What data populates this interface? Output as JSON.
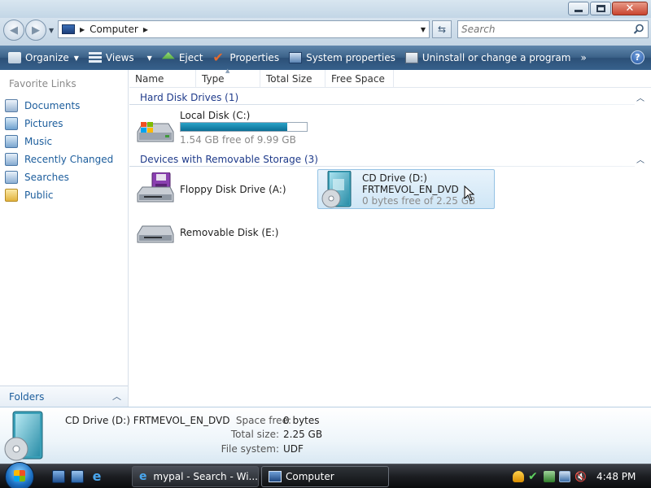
{
  "address": {
    "location": "Computer",
    "search_placeholder": "Search"
  },
  "toolbar": {
    "organize": "Organize",
    "views": "Views",
    "eject": "Eject",
    "properties": "Properties",
    "system_properties": "System properties",
    "uninstall": "Uninstall or change a program",
    "more": "»",
    "help": "?"
  },
  "nav": {
    "favorites_title": "Favorite Links",
    "items": [
      {
        "label": "Documents"
      },
      {
        "label": "Pictures"
      },
      {
        "label": "Music"
      },
      {
        "label": "Recently Changed"
      },
      {
        "label": "Searches"
      },
      {
        "label": "Public"
      }
    ],
    "folders_label": "Folders"
  },
  "columns": {
    "name": "Name",
    "type": "Type",
    "total_size": "Total Size",
    "free_space": "Free Space"
  },
  "groups": {
    "hard_disk": {
      "title": "Hard Disk Drives (1)",
      "items": [
        {
          "label": "Local Disk (C:)",
          "free_text": "1.54 GB free of 9.99 GB",
          "used_fraction": 0.846
        }
      ]
    },
    "removable": {
      "title": "Devices with Removable Storage (3)",
      "items": [
        {
          "label": "Floppy Disk Drive (A:)"
        },
        {
          "label": "CD Drive (D:)",
          "volume": "FRTMEVOL_EN_DVD",
          "free_text": "0 bytes free of 2.25 GB"
        },
        {
          "label": "Removable Disk (E:)"
        }
      ]
    }
  },
  "details": {
    "name": "CD Drive (D:) FRTMEVOL_EN_DVD",
    "space_free_label": "Space free:",
    "space_free": "0 bytes",
    "total_size_label": "Total size:",
    "total_size": "2.25 GB",
    "file_system_label": "File system:",
    "file_system": "UDF"
  },
  "taskbar": {
    "tasks": [
      {
        "label": "mypal - Search - Wi..."
      },
      {
        "label": "Computer"
      }
    ],
    "clock": "4:48 PM"
  }
}
